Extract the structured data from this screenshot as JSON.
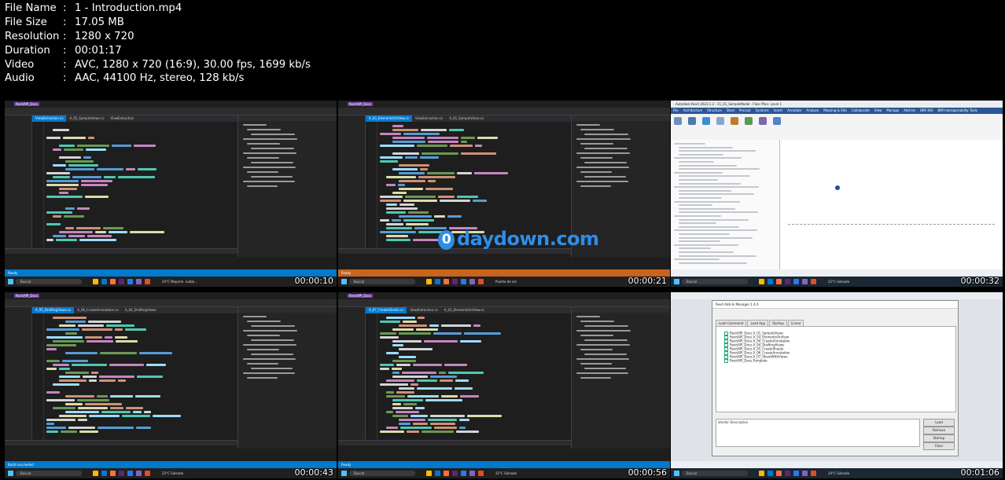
{
  "file_info": [
    {
      "label": "File Name",
      "value": "1 - Introduction.mp4"
    },
    {
      "label": "File Size",
      "value": "17.05 MB"
    },
    {
      "label": "Resolution",
      "value": "1280 x 720"
    },
    {
      "label": "Duration",
      "value": "00:01:17"
    },
    {
      "label": "Video",
      "value": "AVC, 1280 x 720 (16:9), 30.00 fps, 1699 kb/s"
    },
    {
      "label": "Audio",
      "value": "AAC, 44100 Hz, stereo, 128 kb/s"
    }
  ],
  "separator": ":",
  "watermark": {
    "mark": "0",
    "text": "daydown.com",
    "color": "#2e8ee8"
  },
  "thumbnails": [
    {
      "timestamp": "00:00:10",
      "app": "visual-studio",
      "title": "RevitAPI_Docs",
      "tabs": [
        "ViewExtraction.cs",
        "A_05_SampleViews.cs",
        "ViewExtraction"
      ],
      "status": "Ready",
      "status_color": "#007acc",
      "taskbar_search": "Buscar",
      "weather": "24°C  Mayorm. nubla..."
    },
    {
      "timestamp": "00:00:21",
      "app": "visual-studio",
      "title": "RevitAPI_Docs",
      "tabs": [
        "A_03_ElementsOnView.cs",
        "ViewExtraction.cs",
        "A_01_SampleViews.cs"
      ],
      "status": "Ready",
      "status_color": "#c8641e",
      "taskbar_search": "Buscar",
      "weather": "Puesta de sol"
    },
    {
      "timestamp": "00:00:32",
      "app": "revit",
      "title": "Autodesk Revit 2023.1.2 - 21_01_SampleModel - Floor Plan: Level 1",
      "menu": [
        "File",
        "Architecture",
        "Structure",
        "Steel",
        "Precast",
        "Systems",
        "Insert",
        "Annotate",
        "Analyze",
        "Massing & Site",
        "Collaborate",
        "View",
        "Manage",
        "Add-Ins",
        "BIM 360",
        "BIM Interoperability Tools"
      ],
      "taskbar_search": "Buscar",
      "weather": "22°C  Soleado"
    },
    {
      "timestamp": "00:00:43",
      "app": "visual-studio",
      "title": "RevitAPI_Docs",
      "tabs": [
        "A_05_DraftingViews.cs",
        "A_06_CreateAnnotation.cs",
        "A_04_DraftingViews"
      ],
      "status": "Build succeeded",
      "status_color": "#007acc",
      "taskbar_search": "Buscar",
      "weather": "22°C  Soleado"
    },
    {
      "timestamp": "00:00:56",
      "app": "visual-studio",
      "title": "RevitAPI_Docs",
      "tabs": [
        "A_07_CreateSheets.cs",
        "ViewExtraction.cs",
        "A_03_ElementsOnView.cs"
      ],
      "status": "Ready",
      "status_color": "#007acc",
      "taskbar_search": "Buscar",
      "weather": "22°C  Soleado"
    },
    {
      "timestamp": "00:01:06",
      "app": "revit-addin",
      "title": "Revit Add-In Manager 1.4.0",
      "dialog_tabs": [
        "Load Command",
        "Load App",
        "Startup",
        "Linear"
      ],
      "commands": [
        "RevitAPI_Docs.A_01_SampleViews",
        "RevitAPI_Docs.A_03_ElementsOnView",
        "RevitAPI_Docs.A_04_CreateAnnotation",
        "RevitAPI_Docs.A_04_DraftingViews",
        "RevitAPI_Docs.A_05_CreateSheets",
        "RevitAPI_Docs.A_06_CreateAnnotation",
        "RevitAPI_Docs.A_07_SheetWithViews",
        "RevitAPI_Docs.Template"
      ],
      "buttons": [
        "Load",
        "Remove",
        "Startup",
        "Clear"
      ],
      "description_label": "Vendor Description",
      "taskbar_search": "Buscar",
      "weather": "24°C  Soleado"
    }
  ]
}
